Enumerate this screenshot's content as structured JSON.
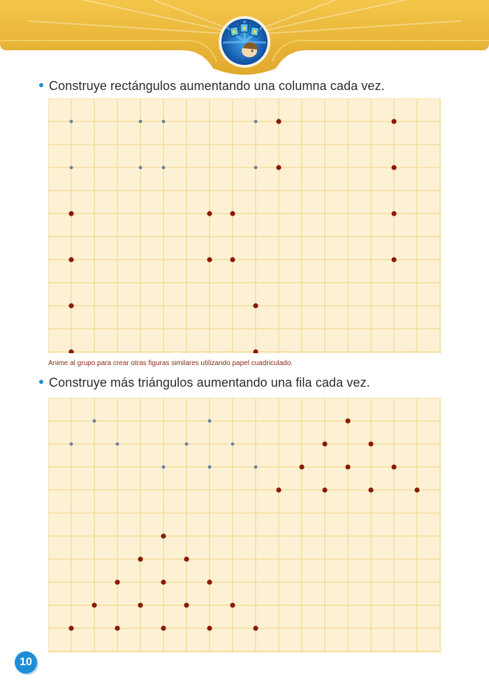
{
  "header": {
    "emblem_icon": "star-rays-emblem-icon"
  },
  "section1": {
    "instruction": "Construye rectángulos aumentando una columna cada vez.",
    "grid": {
      "cols": 17,
      "rows": 11,
      "blue_dots": [
        [
          1,
          1
        ],
        [
          4,
          1
        ],
        [
          5,
          1
        ],
        [
          9,
          1
        ],
        [
          1,
          3
        ],
        [
          4,
          3
        ],
        [
          5,
          3
        ],
        [
          9,
          3
        ]
      ],
      "red_dots": [
        [
          10,
          1
        ],
        [
          15,
          1
        ],
        [
          10,
          3
        ],
        [
          15,
          3
        ],
        [
          1,
          5
        ],
        [
          7,
          5
        ],
        [
          8,
          5
        ],
        [
          15,
          5
        ],
        [
          1,
          7
        ],
        [
          7,
          7
        ],
        [
          8,
          7
        ],
        [
          15,
          7
        ],
        [
          1,
          9
        ],
        [
          9,
          9
        ],
        [
          1,
          11
        ],
        [
          9,
          11
        ]
      ]
    }
  },
  "teacher_note": "Anime al grupo para crear otras figuras similares utilizando papel cuadriculado.",
  "section2": {
    "instruction": "Construye más triángulos aumentando una fila cada vez.",
    "grid": {
      "cols": 17,
      "rows": 11,
      "blue_dots": [
        [
          2,
          1
        ],
        [
          7,
          1
        ],
        [
          1,
          2
        ],
        [
          3,
          2
        ],
        [
          6,
          2
        ],
        [
          8,
          2
        ],
        [
          5,
          3
        ],
        [
          7,
          3
        ],
        [
          9,
          3
        ]
      ],
      "red_dots": [
        [
          13,
          1
        ],
        [
          12,
          2
        ],
        [
          14,
          2
        ],
        [
          11,
          3
        ],
        [
          13,
          3
        ],
        [
          15,
          3
        ],
        [
          10,
          4
        ],
        [
          12,
          4
        ],
        [
          14,
          4
        ],
        [
          16,
          4
        ],
        [
          5,
          6
        ],
        [
          4,
          7
        ],
        [
          6,
          7
        ],
        [
          3,
          8
        ],
        [
          5,
          8
        ],
        [
          7,
          8
        ],
        [
          2,
          9
        ],
        [
          4,
          9
        ],
        [
          6,
          9
        ],
        [
          8,
          9
        ],
        [
          1,
          10
        ],
        [
          3,
          10
        ],
        [
          5,
          10
        ],
        [
          7,
          10
        ],
        [
          9,
          10
        ]
      ]
    }
  },
  "page_number": "10",
  "colors": {
    "banner_gold": "#e9b63a",
    "grid_bg": "#fdf1d5",
    "grid_line": "#f2d98f",
    "dot_blue": "#6b7fa8",
    "dot_red": "#8b1a0a",
    "accent_blue": "#1e8ed8"
  }
}
